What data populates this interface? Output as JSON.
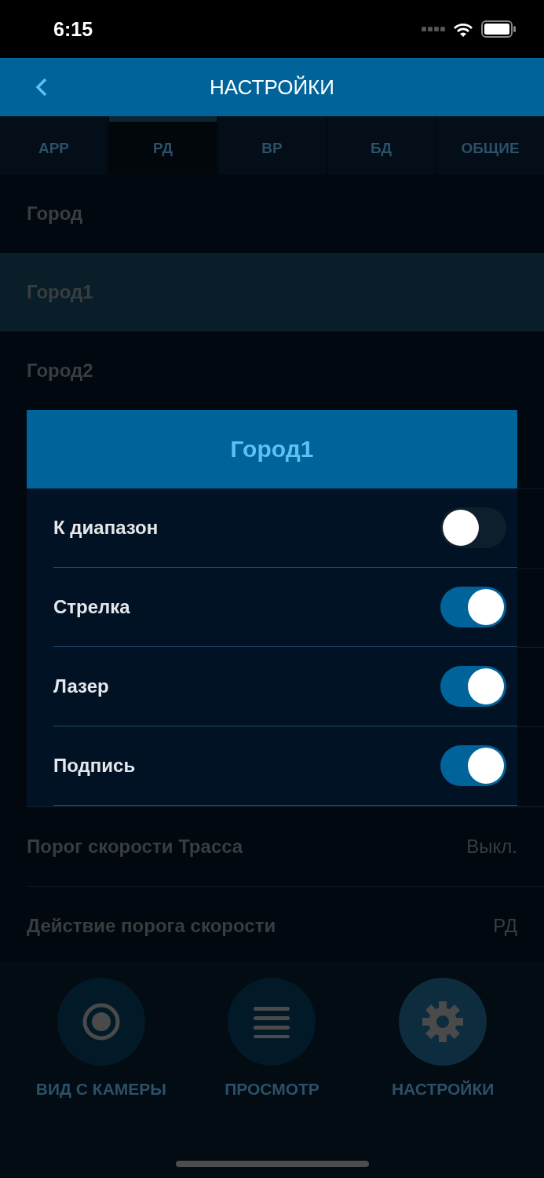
{
  "status_bar": {
    "time": "6:15"
  },
  "header": {
    "title": "НАСТРОЙКИ"
  },
  "tabs": [
    {
      "label": "APP",
      "selected": false
    },
    {
      "label": "РД",
      "selected": true
    },
    {
      "label": "ВР",
      "selected": false
    },
    {
      "label": "БД",
      "selected": false
    },
    {
      "label": "ОБЩИЕ",
      "selected": false
    }
  ],
  "list_top": [
    {
      "label": "Город",
      "selected": false
    },
    {
      "label": "Город1",
      "selected": true
    },
    {
      "label": "Город2",
      "selected": false
    }
  ],
  "list_bottom": [
    {
      "label": "Порог скорости Трасса",
      "value": "Выкл."
    },
    {
      "label": "Действие порога скорости",
      "value": "РД"
    }
  ],
  "dialog": {
    "title": "Город1",
    "options": [
      {
        "label": "К диапазон",
        "on": false
      },
      {
        "label": "Стрелка",
        "on": true
      },
      {
        "label": "Лазер",
        "on": true
      },
      {
        "label": "Подпись",
        "on": true
      }
    ]
  },
  "bottom_nav": [
    {
      "kind": "camera",
      "label": "ВИД С КАМЕРЫ",
      "selected": false
    },
    {
      "kind": "list",
      "label": "ПРОСМОТР",
      "selected": false
    },
    {
      "kind": "settings",
      "label": "НАСТРОЙКИ",
      "selected": true
    }
  ]
}
